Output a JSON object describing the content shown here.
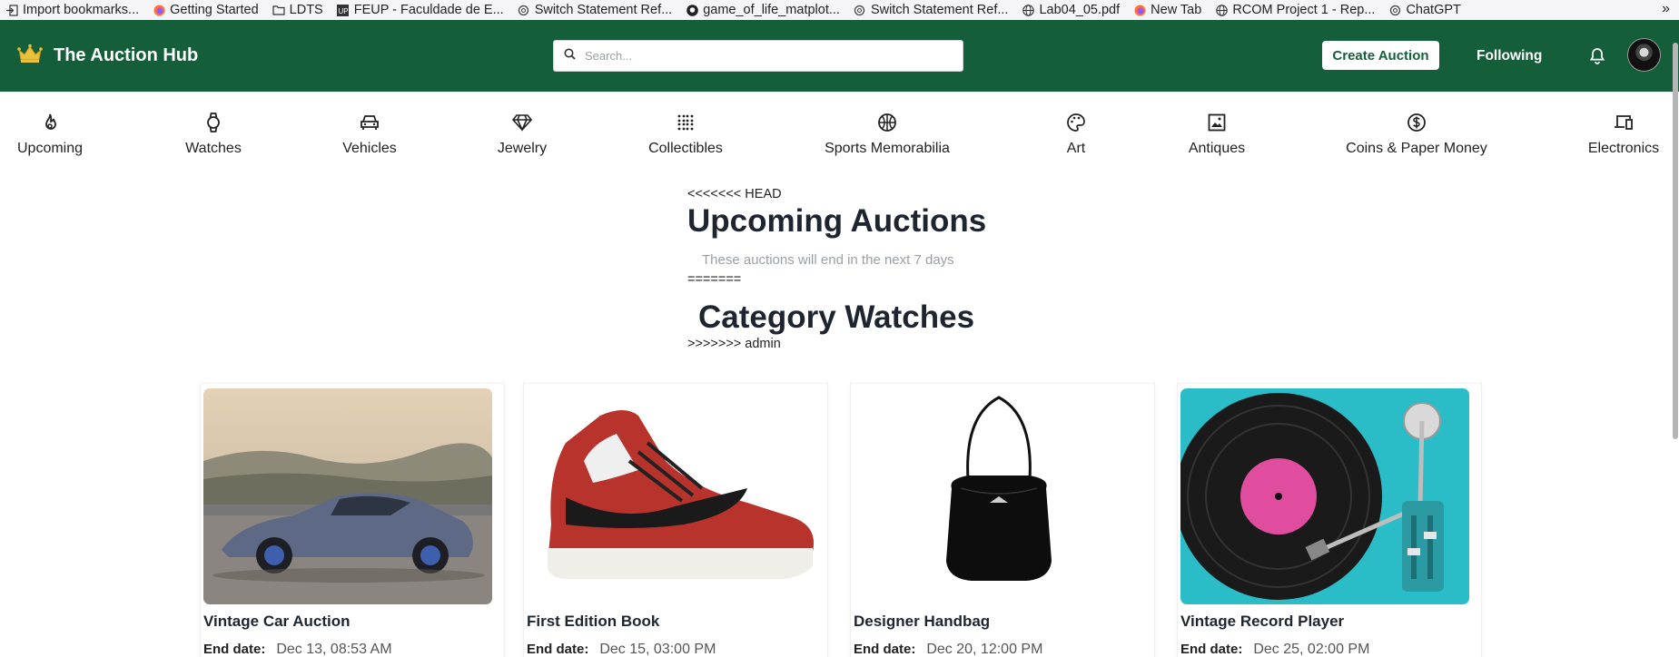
{
  "bookmarks": [
    {
      "label": "Import bookmarks...",
      "icon": "import-icon"
    },
    {
      "label": "Getting Started",
      "icon": "firefox-icon"
    },
    {
      "label": "LDTS",
      "icon": "folder-icon"
    },
    {
      "label": "FEUP - Faculdade de E...",
      "icon": "feup-icon"
    },
    {
      "label": "Switch Statement Ref...",
      "icon": "openai-icon"
    },
    {
      "label": "game_of_life_matplot...",
      "icon": "github-icon"
    },
    {
      "label": "Switch Statement Ref...",
      "icon": "openai-icon"
    },
    {
      "label": "Lab04_05.pdf",
      "icon": "globe-icon"
    },
    {
      "label": "New Tab",
      "icon": "firefox-icon"
    },
    {
      "label": "RCOM Project 1 - Rep...",
      "icon": "globe-icon"
    },
    {
      "label": "ChatGPT",
      "icon": "openai-icon"
    }
  ],
  "bookmarks_more": "»",
  "header": {
    "brand": "The Auction Hub",
    "search_placeholder": "Search...",
    "create_label": "Create Auction",
    "following_label": "Following"
  },
  "categories": [
    {
      "label": "Upcoming",
      "icon": "flame-icon"
    },
    {
      "label": "Watches",
      "icon": "watch-icon"
    },
    {
      "label": "Vehicles",
      "icon": "car-icon"
    },
    {
      "label": "Jewelry",
      "icon": "diamond-icon"
    },
    {
      "label": "Collectibles",
      "icon": "grid-icon"
    },
    {
      "label": "Sports Memorabilia",
      "icon": "basketball-icon"
    },
    {
      "label": "Art",
      "icon": "palette-icon"
    },
    {
      "label": "Antiques",
      "icon": "image-icon"
    },
    {
      "label": "Coins & Paper Money",
      "icon": "dollar-icon"
    },
    {
      "label": "Electronics",
      "icon": "devices-icon"
    }
  ],
  "main": {
    "conflict_head": "<<<<<<< HEAD",
    "title_upcoming": "Upcoming Auctions",
    "subtitle": "These auctions will end in the next 7 days",
    "conflict_sep": "=======",
    "title_category": "Category Watches",
    "conflict_end": ">>>>>>> admin"
  },
  "end_date_label": "End date:",
  "auctions": [
    {
      "title": "Vintage Car Auction",
      "end": "Dec 13, 08:53 AM"
    },
    {
      "title": "First Edition Book",
      "end": "Dec 15, 03:00 PM"
    },
    {
      "title": "Designer Handbag",
      "end": "Dec 20, 12:00 PM"
    },
    {
      "title": "Vintage Record Player",
      "end": "Dec 25, 02:00 PM"
    }
  ],
  "colors": {
    "brand_green": "#155e3a",
    "heading": "#1f2530",
    "muted": "#9a9fa6"
  }
}
